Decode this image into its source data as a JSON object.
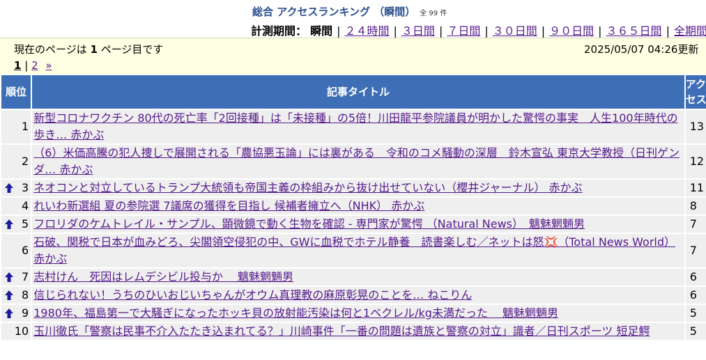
{
  "header": {
    "title": "総合 アクセスランキング （瞬間）",
    "total": "全 99 件",
    "period_label": "計測期間：",
    "period_current": "瞬間",
    "period_links": [
      "２４時間",
      "３日間",
      "７日間",
      "３０日間",
      "９０日間",
      "３６５日間",
      "全期間"
    ]
  },
  "info": {
    "page_text_before": "現在のページは",
    "page_number": "1",
    "page_text_after": "ページ目です",
    "updated": "2025/05/07 04:26更新"
  },
  "pager": {
    "current": "1",
    "next_page": "2",
    "next_arrow": "»"
  },
  "table": {
    "headers": {
      "rank": "順位",
      "title": "記事タイトル",
      "access": "アクセス"
    },
    "rows": [
      {
        "rank": "1",
        "up": false,
        "title": "新型コロナワクチン 80代の死亡率「2回接種」は「未接種」の5倍！川田龍平参院議員が明かした驚愕の事実　人生100年時代の歩き… 赤かぶ",
        "access": "13"
      },
      {
        "rank": "2",
        "up": false,
        "title": "（6）米価高騰の犯人捜しで展開される「農協悪玉論」には裏がある　令和のコメ騒動の深層　鈴木宣弘 東京大学教授（日刊ゲンダ… 赤かぶ",
        "access": "12"
      },
      {
        "rank": "3",
        "up": true,
        "title": "ネオコンと対立しているトランプ大統領も帝国主義の枠組みから抜け出せていない（櫻井ジャーナル） 赤かぶ",
        "access": "11"
      },
      {
        "rank": "4",
        "up": false,
        "title": "れいわ新選組 夏の参院選 7議席の獲得を目指し 候補者擁立へ（NHK） 赤かぶ",
        "access": "8"
      },
      {
        "rank": "5",
        "up": true,
        "title": "フロリダのケムトレイル・サンプル、顕微鏡で動く生物を確認 - 専門家が驚愕 （Natural News）　魑魅魍魎男",
        "access": "7"
      },
      {
        "rank": "6",
        "up": false,
        "title": "石破、関税で日本が血みどろ、尖閣領空侵犯の中、GWに血税でホテル静養　読書楽しむ／ネットは怒💢（Total News World） 赤かぶ",
        "access": "7"
      },
      {
        "rank": "7",
        "up": true,
        "title": "志村けん　死因はレムデシビル投与か　 魑魅魍魎男",
        "access": "6"
      },
      {
        "rank": "8",
        "up": true,
        "title": "信じられない！うちのひいおじいちゃんがオウム真理教の麻原彰晃のことを… ねこりん",
        "access": "6"
      },
      {
        "rank": "9",
        "up": true,
        "title": "1980年、福島第一で大騒ぎになったホッキ貝の放射能汚染は何と1ベクレル/kg未満だった　 魑魅魍魎男",
        "access": "5"
      },
      {
        "rank": "10",
        "up": false,
        "title": "玉川徹氏「警察は民事不介入たたき込まれてる？」川崎事件「一番の問題は遺族と警察の対立」識者／日刊スポーツ 短足鰐",
        "access": "5"
      }
    ]
  },
  "colors": {
    "header_bg": "#3e6fb6",
    "info_bg": "#ffffe3",
    "row_bg": "#efefef",
    "link": "#551a8b",
    "title": "#2a4f8f",
    "up_arrow": "#1d1d9b"
  }
}
